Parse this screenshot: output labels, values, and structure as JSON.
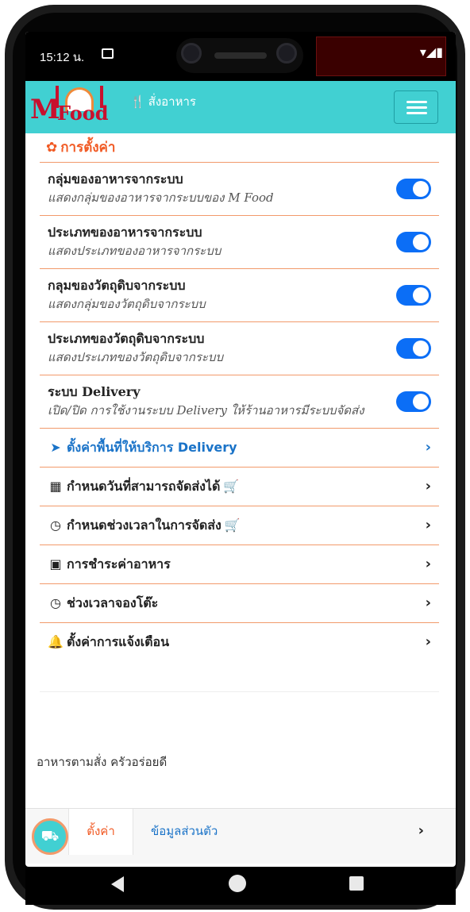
{
  "status_bar": {
    "time": "15:12 น.",
    "system_icons": "▾◢▮"
  },
  "app_bar": {
    "logo_m": "M",
    "logo_food": "Food",
    "title": "สั่งอาหาร",
    "utensil_icon": "🍴"
  },
  "settings": {
    "heading": "การตั้งค่า",
    "toggles": [
      {
        "title": "กลุ่มของอาหารจากระบบ",
        "subtitle": "แสดงกลุ่มของอาหารจากระบบของ M Food",
        "on": true
      },
      {
        "title": "ประเภทของอาหารจากระบบ",
        "subtitle": "แสดงประเภทของอาหารจากระบบ",
        "on": true
      },
      {
        "title": "กลุมของวัตถุดิบจากระบบ",
        "subtitle": "แสดงกลุ่มของวัตถุดิบจากระบบ",
        "on": true
      },
      {
        "title": "ประเภทของวัตถุดิบจากระบบ",
        "subtitle": "แสดงประเภทของวัตถุดิบจากระบบ",
        "on": true
      },
      {
        "title": "ระบบ Delivery",
        "subtitle": "เปิด/ปิด การใช้งานระบบ Delivery ให้ร้านอาหารมีระบบจัดส่ง",
        "on": true
      }
    ],
    "nav_items": [
      {
        "label": "ตั้งค่าพื้นที่ให้บริการ Delivery",
        "icon": "➤",
        "color": "#1a73c8"
      },
      {
        "label": "กำหนดวันที่สามารถจัดส่งได้",
        "icon": "▦"
      },
      {
        "label": "กำหนดช่วงเวลาในการจัดส่ง",
        "icon": "◷"
      },
      {
        "label": "การชำระค่าอาหาร",
        "icon": "▣"
      },
      {
        "label": "ช่วงเวลาจองโต๊ะ",
        "icon": "◷"
      },
      {
        "label": "ตั้งค่าการแจ้งเตือน",
        "icon": "🔔"
      }
    ],
    "chevron": "›"
  },
  "footer": {
    "text": "อาหารตามสั่ง ครัวอร่อยดี"
  },
  "bottom_bar": {
    "settings_tab": "ตั้งค่า",
    "profile_tab": "ข้อมูลส่วนตัว",
    "chevron": "›"
  },
  "colors": {
    "accent": "#41d0d2",
    "orange": "#f15a24",
    "blue": "#1a73c8",
    "toggle": "#0b6ef6"
  }
}
